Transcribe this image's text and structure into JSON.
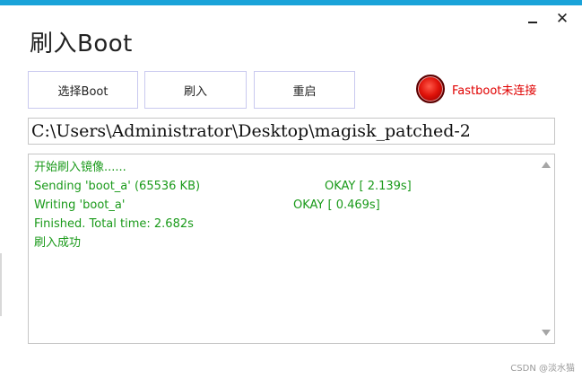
{
  "window": {
    "title": "刷入Boot",
    "minimize_label": "",
    "close_label": "✕"
  },
  "toolbar": {
    "select_label": "选择Boot",
    "flash_label": "刷入",
    "reboot_label": "重启"
  },
  "status": {
    "text": "Fastboot未连接",
    "color": "#e00000"
  },
  "path": {
    "value": "C:\\Users\\Administrator\\Desktop\\magisk_patched-2"
  },
  "log": {
    "lines": [
      {
        "left": "开始刷入镜像......",
        "right": ""
      },
      {
        "left": "Sending 'boot_a' (65536 KB)",
        "right": "OKAY [  2.139s]"
      },
      {
        "left": "Writing 'boot_a'",
        "right": "OKAY [  0.469s]"
      },
      {
        "left": "Finished. Total time: 2.682s",
        "right": ""
      },
      {
        "left": "刷入成功",
        "right": ""
      }
    ],
    "color": "#1a9a1a"
  },
  "watermark": "CSDN @淡水猫"
}
